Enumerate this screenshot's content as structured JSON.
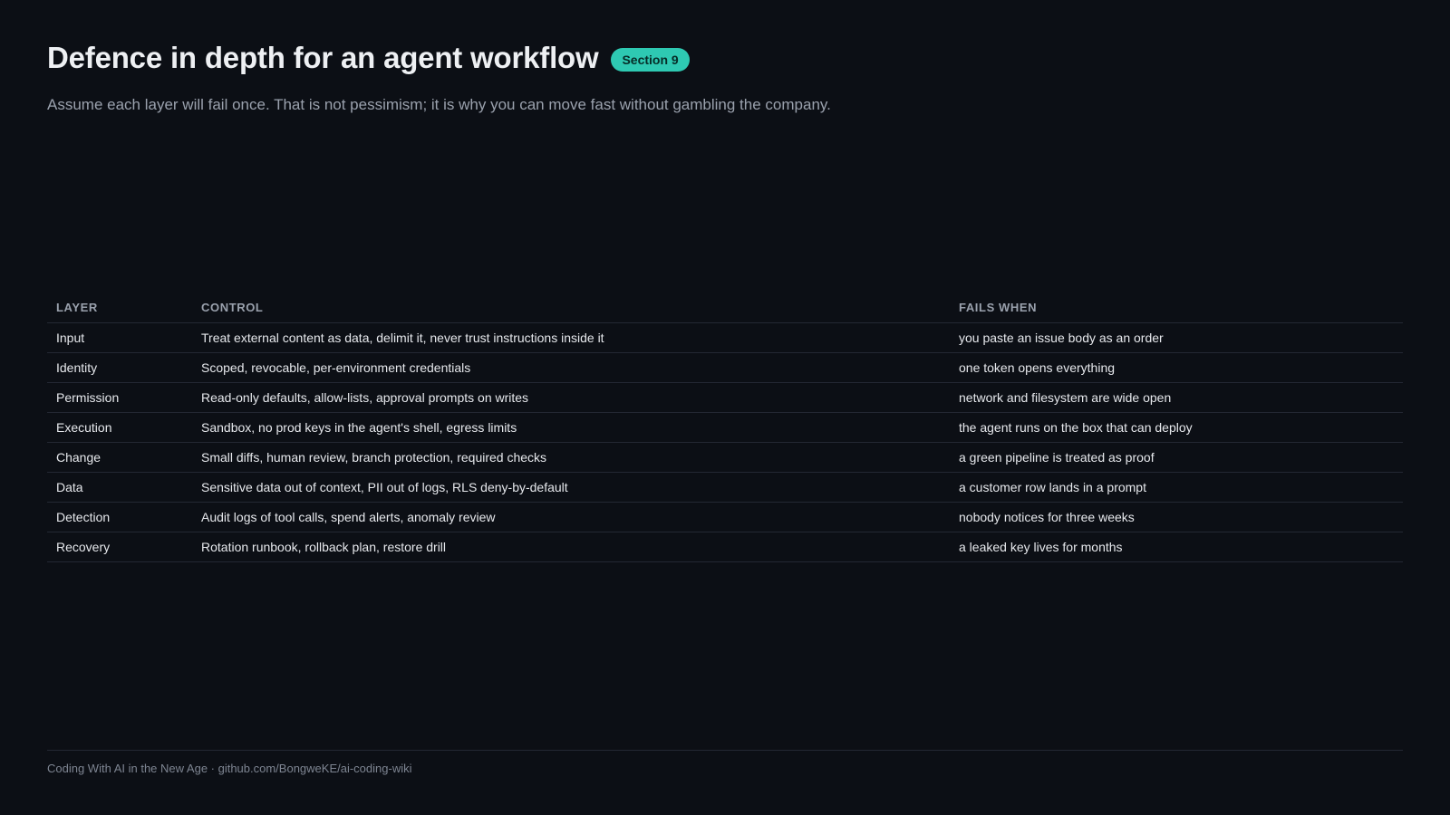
{
  "header": {
    "title": "Defence in depth for an agent workflow",
    "badge": "Section 9"
  },
  "subtitle": "Assume each layer will fail once. That is not pessimism; it is why you can move fast without gambling the company.",
  "table": {
    "columns": [
      "LAYER",
      "CONTROL",
      "FAILS WHEN"
    ],
    "rows": [
      [
        "Input",
        "Treat external content as data, delimit it, never trust instructions inside it",
        "you paste an issue body as an order"
      ],
      [
        "Identity",
        "Scoped, revocable, per-environment credentials",
        "one token opens everything"
      ],
      [
        "Permission",
        "Read-only defaults, allow-lists, approval prompts on writes",
        "network and filesystem are wide open"
      ],
      [
        "Execution",
        "Sandbox, no prod keys in the agent's shell, egress limits",
        "the agent runs on the box that can deploy"
      ],
      [
        "Change",
        "Small diffs, human review, branch protection, required checks",
        "a green pipeline is treated as proof"
      ],
      [
        "Data",
        "Sensitive data out of context, PII out of logs, RLS deny-by-default",
        "a customer row lands in a prompt"
      ],
      [
        "Detection",
        "Audit logs of tool calls, spend alerts, anomaly review",
        "nobody notices for three weeks"
      ],
      [
        "Recovery",
        "Rotation runbook, rollback plan, restore drill",
        "a leaked key lives for months"
      ]
    ]
  },
  "footer": "Coding With AI in the New Age · github.com/BongweKE/ai-coding-wiki"
}
